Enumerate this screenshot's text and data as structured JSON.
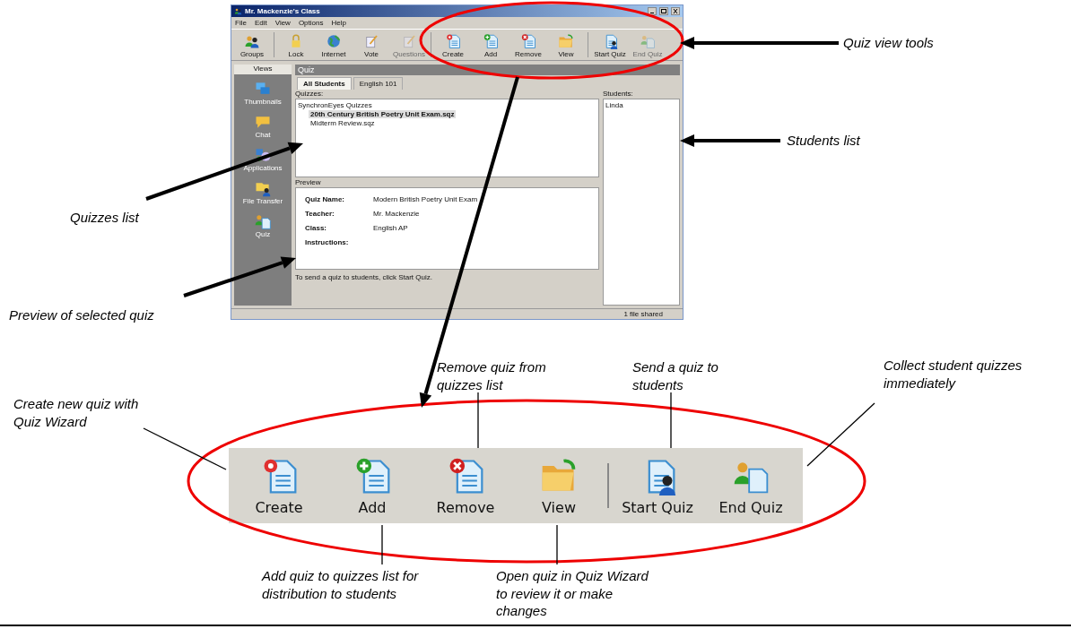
{
  "window": {
    "title": "Mr. Mackenzie's Class",
    "menu": [
      "File",
      "Edit",
      "View",
      "Options",
      "Help"
    ],
    "toolbar": [
      {
        "label": "Groups",
        "disabled": false
      },
      {
        "label": "Lock",
        "disabled": false
      },
      {
        "label": "Internet",
        "disabled": false
      },
      {
        "label": "Vote",
        "disabled": false
      },
      {
        "label": "Questions",
        "disabled": true
      },
      {
        "label": "Create",
        "disabled": false
      },
      {
        "label": "Add",
        "disabled": false
      },
      {
        "label": "Remove",
        "disabled": false
      },
      {
        "label": "View",
        "disabled": false
      },
      {
        "label": "Start Quiz",
        "disabled": false
      },
      {
        "label": "End Quiz",
        "disabled": true
      }
    ],
    "views_header": "Views",
    "views": [
      "Thumbnails",
      "Chat",
      "Applications",
      "File Transfer",
      "Quiz"
    ],
    "panel_title": "Quiz",
    "tabs": [
      {
        "label": "All Students",
        "selected": true
      },
      {
        "label": "English 101",
        "selected": false
      }
    ],
    "quizzes_label": "Quizzes:",
    "quiz_tree": {
      "label": "SynchronEyes Quizzes",
      "children": [
        {
          "label": "20th Century British Poetry Unit Exam.sqz",
          "selected": true
        },
        {
          "label": "Midterm Review.sqz",
          "selected": false
        }
      ]
    },
    "students_label": "Students:",
    "students": [
      "Linda"
    ],
    "preview_label": "Preview",
    "preview": [
      {
        "label": "Quiz Name:",
        "value": "Modern British Poetry Unit Exam"
      },
      {
        "label": "Teacher:",
        "value": "Mr. Mackenzie"
      },
      {
        "label": "Class:",
        "value": "English AP"
      },
      {
        "label": "Instructions:"
      }
    ],
    "hint": "To send a quiz to students, click Start Quiz.",
    "status": "1 file shared"
  },
  "zoomed_toolbar": [
    "Create",
    "Add",
    "Remove",
    "View",
    "Start Quiz",
    "End Quiz"
  ],
  "callouts": [
    "Quiz view tools",
    "Students list",
    "Quizzes list",
    "Preview of selected quiz",
    "Remove quiz from quizzes list",
    "Send a quiz to students",
    "Collect student quizzes immediately",
    "Create new quiz with Quiz Wizard",
    "Add quiz to quizzes list for distribution to students",
    "Open quiz in Quiz Wizard to review it or make changes"
  ]
}
